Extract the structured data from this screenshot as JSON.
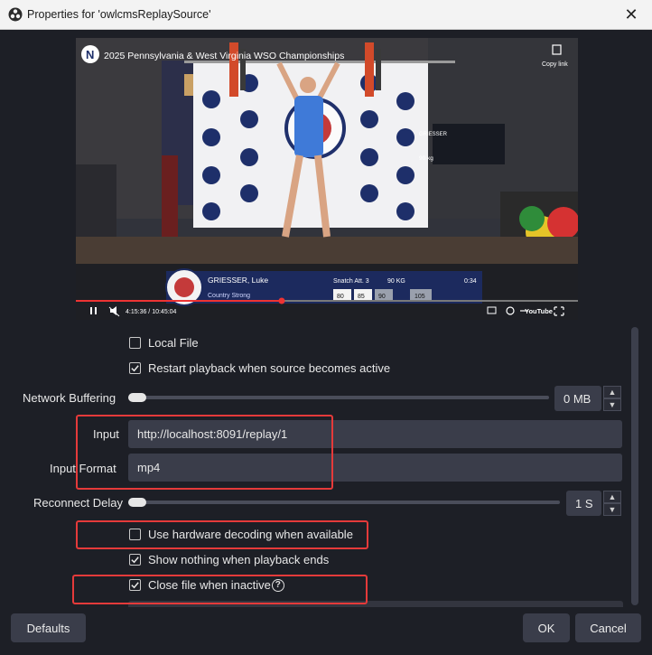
{
  "window": {
    "title": "Properties for 'owlcmsReplaySource'",
    "close_glyph": "✕",
    "app_icon": "obs-icon"
  },
  "video": {
    "title": "2025 Pennsylvania & West Virginia WSO Championships",
    "copy_link": "Copy link",
    "channel_badge": "N",
    "scoreboard": {
      "name": "GRIESSER, Luke",
      "team": "Country Strong",
      "attempt": "Snatch Att. 3",
      "weight": "90 KG",
      "clock": "0:34",
      "attempts": [
        "80",
        "85",
        "90",
        "105"
      ]
    },
    "side_board": {
      "name": "GRIESSER",
      "weight": "90 kg"
    },
    "time": "4:15:36 / 10:45:04",
    "progress": 0.41,
    "youtube_label": "YouTube"
  },
  "options": {
    "local_file": {
      "label": "Local File",
      "checked": false
    },
    "restart_playback": {
      "label": "Restart playback when source becomes active",
      "checked": true
    },
    "network_buffering": {
      "label": "Network Buffering",
      "value": "0 MB",
      "level": 0
    },
    "input": {
      "label": "Input",
      "value": "http://localhost:8091/replay/1"
    },
    "input_format": {
      "label": "Input Format",
      "value": "mp4"
    },
    "reconnect_delay": {
      "label": "Reconnect Delay",
      "value": "1 S",
      "level": 0
    },
    "hw_decoding": {
      "label": "Use hardware decoding when available",
      "checked": false
    },
    "show_nothing": {
      "label": "Show nothing when playback ends",
      "checked": true
    },
    "close_file": {
      "label": "Close file when inactive",
      "checked": true,
      "help": "?"
    }
  },
  "footer": {
    "defaults": "Defaults",
    "ok": "OK",
    "cancel": "Cancel"
  },
  "colors": {
    "background": "#1d1f26",
    "field": "#3a3d4a",
    "highlight": "#e53a3a",
    "slider": "#4a4d5a"
  }
}
